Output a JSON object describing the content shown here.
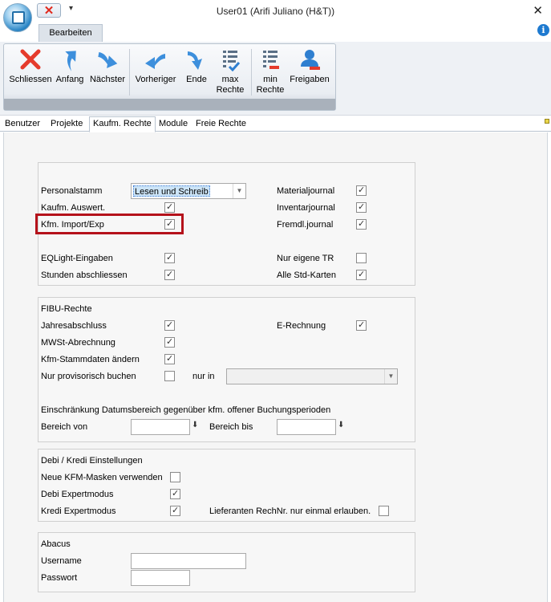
{
  "window": {
    "title": "User01 (Arifi Juliano (H&T))",
    "close_glyph": "✕"
  },
  "quick_access": {
    "close_glyph": "✕",
    "dropdown_glyph": "▾"
  },
  "ribbon": {
    "tab": "Bearbeiten",
    "buttons": [
      {
        "id": "schliessen",
        "label": "Schliessen",
        "icon": "red-x-icon"
      },
      {
        "id": "anfang",
        "label": "Anfang",
        "icon": "arrow-up-icon"
      },
      {
        "id": "naechster",
        "label": "Nächster",
        "icon": "arrow-right-icon"
      },
      {
        "id": "vorheriger",
        "label": "Vorheriger",
        "icon": "arrow-back-icon"
      },
      {
        "id": "ende",
        "label": "Ende",
        "icon": "arrow-down-icon"
      },
      {
        "id": "max_rechte",
        "label1": "max",
        "label2": "Rechte",
        "icon": "list-check-icon"
      },
      {
        "id": "min_rechte",
        "label1": "min",
        "label2": "Rechte",
        "icon": "list-minus-icon"
      },
      {
        "id": "freigaben",
        "label": "Freigaben",
        "icon": "user-icon"
      }
    ]
  },
  "subtabs": [
    "Benutzer",
    "Projekte",
    "Kaufm. Rechte",
    "Module",
    "Freie Rechte"
  ],
  "active_subtab": "Kaufm. Rechte",
  "panel_general": {
    "personalstamm_label": "Personalstamm",
    "personalstamm_value": "Lesen und Schreib",
    "kaufm_auswert": {
      "label": "Kaufm. Auswert.",
      "checked": true
    },
    "kfm_import_exp": {
      "label": "Kfm. Import/Exp",
      "checked": true
    },
    "eqlight": {
      "label": "EQLight-Eingaben",
      "checked": true
    },
    "stunden": {
      "label": "Stunden abschliessen",
      "checked": true
    },
    "materialjournal": {
      "label": "Materialjournal",
      "checked": true
    },
    "inventarjournal": {
      "label": "Inventarjournal",
      "checked": true
    },
    "fremdljournal": {
      "label": "Fremdl.journal",
      "checked": true
    },
    "nur_eigene_tr": {
      "label": "Nur eigene TR",
      "checked": false
    },
    "alle_std_karten": {
      "label": "Alle Std-Karten",
      "checked": true
    },
    "highlight_color": "#b5121b"
  },
  "panel_fibu": {
    "title": "FIBU-Rechte",
    "jahresabschluss": {
      "label": "Jahresabschluss",
      "checked": true
    },
    "mwst": {
      "label": "MWSt-Abrechnung",
      "checked": true
    },
    "kfm_stammdaten": {
      "label": "Kfm-Stammdaten ändern",
      "checked": true
    },
    "nur_provisorisch": {
      "label": "Nur provisorisch buchen",
      "checked": false
    },
    "nur_in_label": "nur in",
    "e_rechnung": {
      "label": "E-Rechnung",
      "checked": true
    },
    "einschraenkung": "Einschränkung Datumsbereich gegenüber kfm. offener Buchungsperioden",
    "bereich_von": "Bereich von",
    "bereich_bis": "Bereich bis"
  },
  "panel_debi": {
    "title": "Debi / Kredi Einstellungen",
    "neue_kfm": {
      "label": "Neue KFM-Masken verwenden",
      "checked": false
    },
    "debi_expert": {
      "label": "Debi Expertmodus",
      "checked": true
    },
    "kredi_expert": {
      "label": "Kredi Expertmodus",
      "checked": true
    },
    "lieferanten": {
      "label": "Lieferanten RechNr. nur einmal erlauben.",
      "checked": false
    }
  },
  "panel_abacus": {
    "title": "Abacus",
    "username_label": "Username",
    "passwort_label": "Passwort",
    "username_value": "",
    "passwort_value": ""
  }
}
